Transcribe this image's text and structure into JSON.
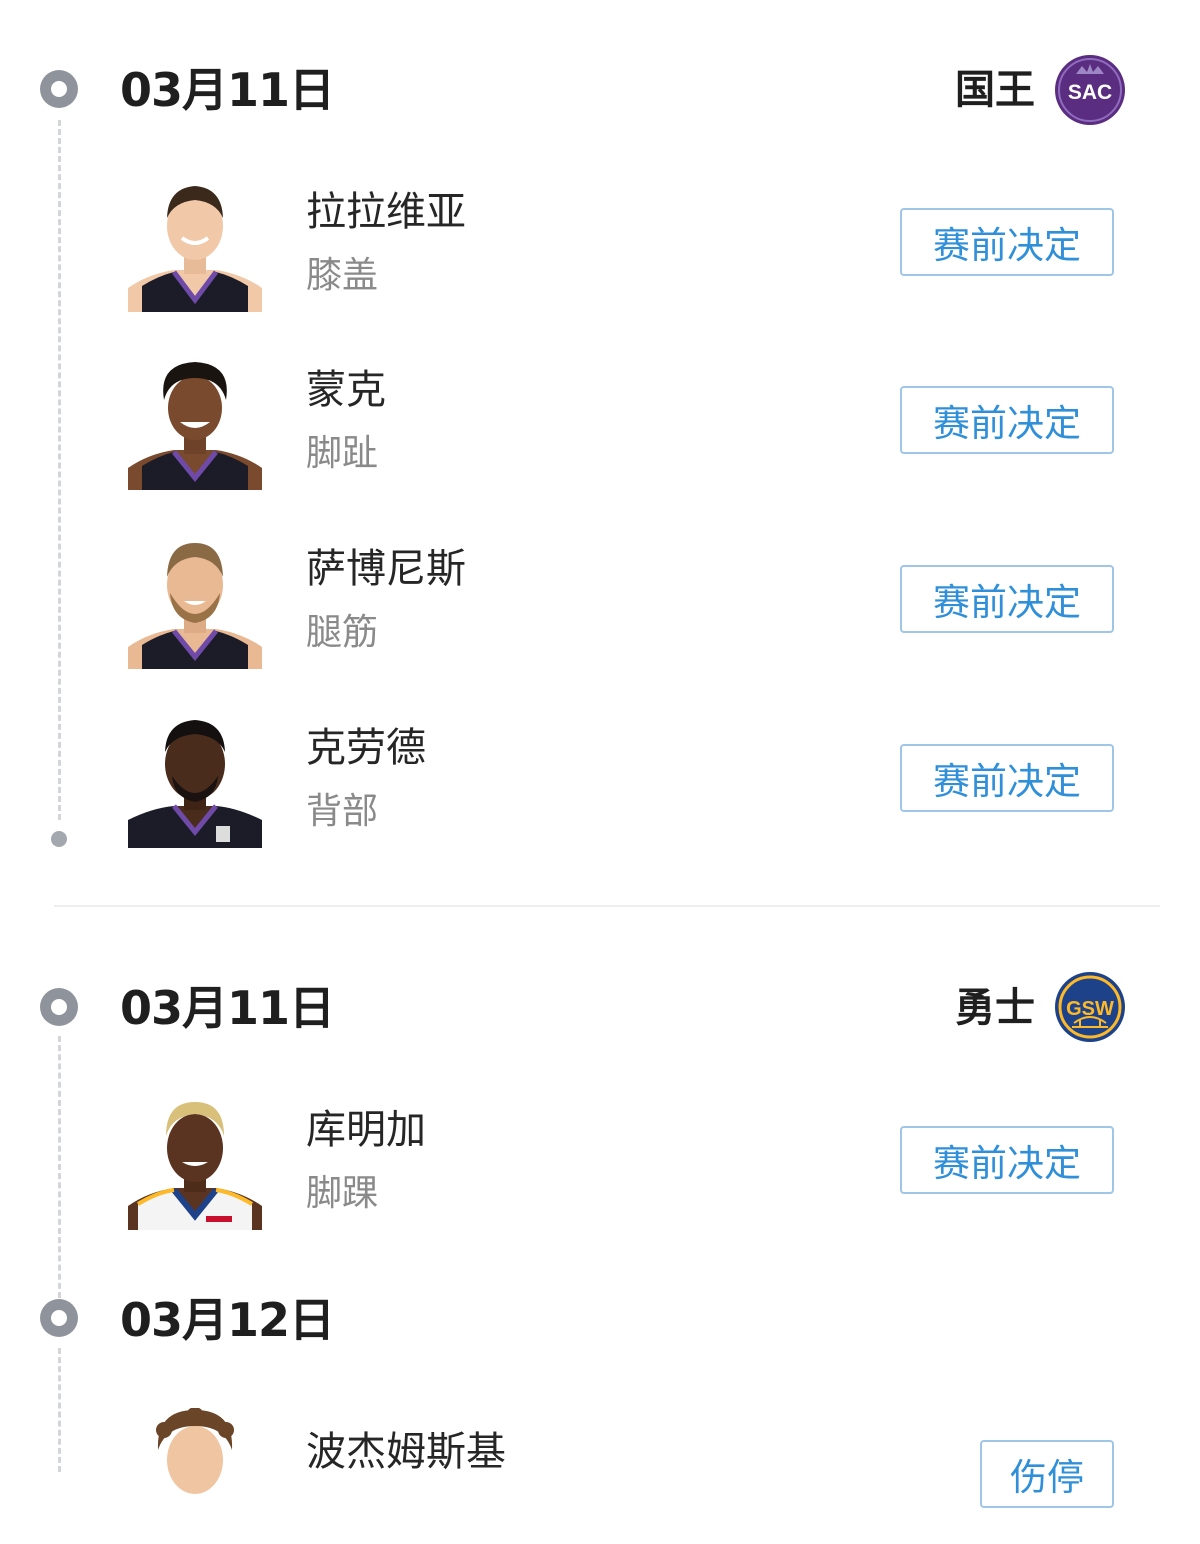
{
  "sections": [
    {
      "date": "03月11日",
      "team_name": "国王",
      "team_logo": {
        "text": "SAC",
        "icon": "kings-logo",
        "color": "#5a2d81"
      },
      "players": [
        {
          "name": "拉拉维亚",
          "injury": "膝盖",
          "status": "赛前决定",
          "jersey_color": "#1c1c28",
          "trim": "#6f4aa8",
          "skin": "#f1c9a8",
          "hair": "#3b2a1c"
        },
        {
          "name": "蒙克",
          "injury": "脚趾",
          "status": "赛前决定",
          "jersey_color": "#1c1c28",
          "trim": "#6f4aa8",
          "skin": "#7a4a2e",
          "hair": "#1a1410"
        },
        {
          "name": "萨博尼斯",
          "injury": "腿筋",
          "status": "赛前决定",
          "jersey_color": "#1c1c28",
          "trim": "#6f4aa8",
          "skin": "#e9b994",
          "hair": "#8a6a44"
        },
        {
          "name": "克劳德",
          "injury": "背部",
          "status": "赛前决定",
          "jersey_color": "#1c1c28",
          "trim": "#6f4aa8",
          "skin": "#4a2c1c",
          "hair": "#141010"
        }
      ]
    },
    {
      "date": "03月11日",
      "team_name": "勇士",
      "team_logo": {
        "text": "GSW",
        "icon": "warriors-logo",
        "color": "#1d428a",
        "accent": "#fdb927"
      },
      "players": [
        {
          "name": "库明加",
          "injury": "脚踝",
          "status": "赛前决定",
          "jersey_color": "#f4f4f4",
          "trim": "#1d428a",
          "skin": "#5a3420",
          "hair": "#d8c07a"
        }
      ]
    },
    {
      "date": "03月12日",
      "team_name": "",
      "players": [
        {
          "name": "波杰姆斯基",
          "injury": "",
          "status": "伤停",
          "jersey_color": "#f4f4f4",
          "trim": "#1d428a",
          "skin": "#f0c6a2",
          "hair": "#6a4528"
        }
      ]
    }
  ]
}
